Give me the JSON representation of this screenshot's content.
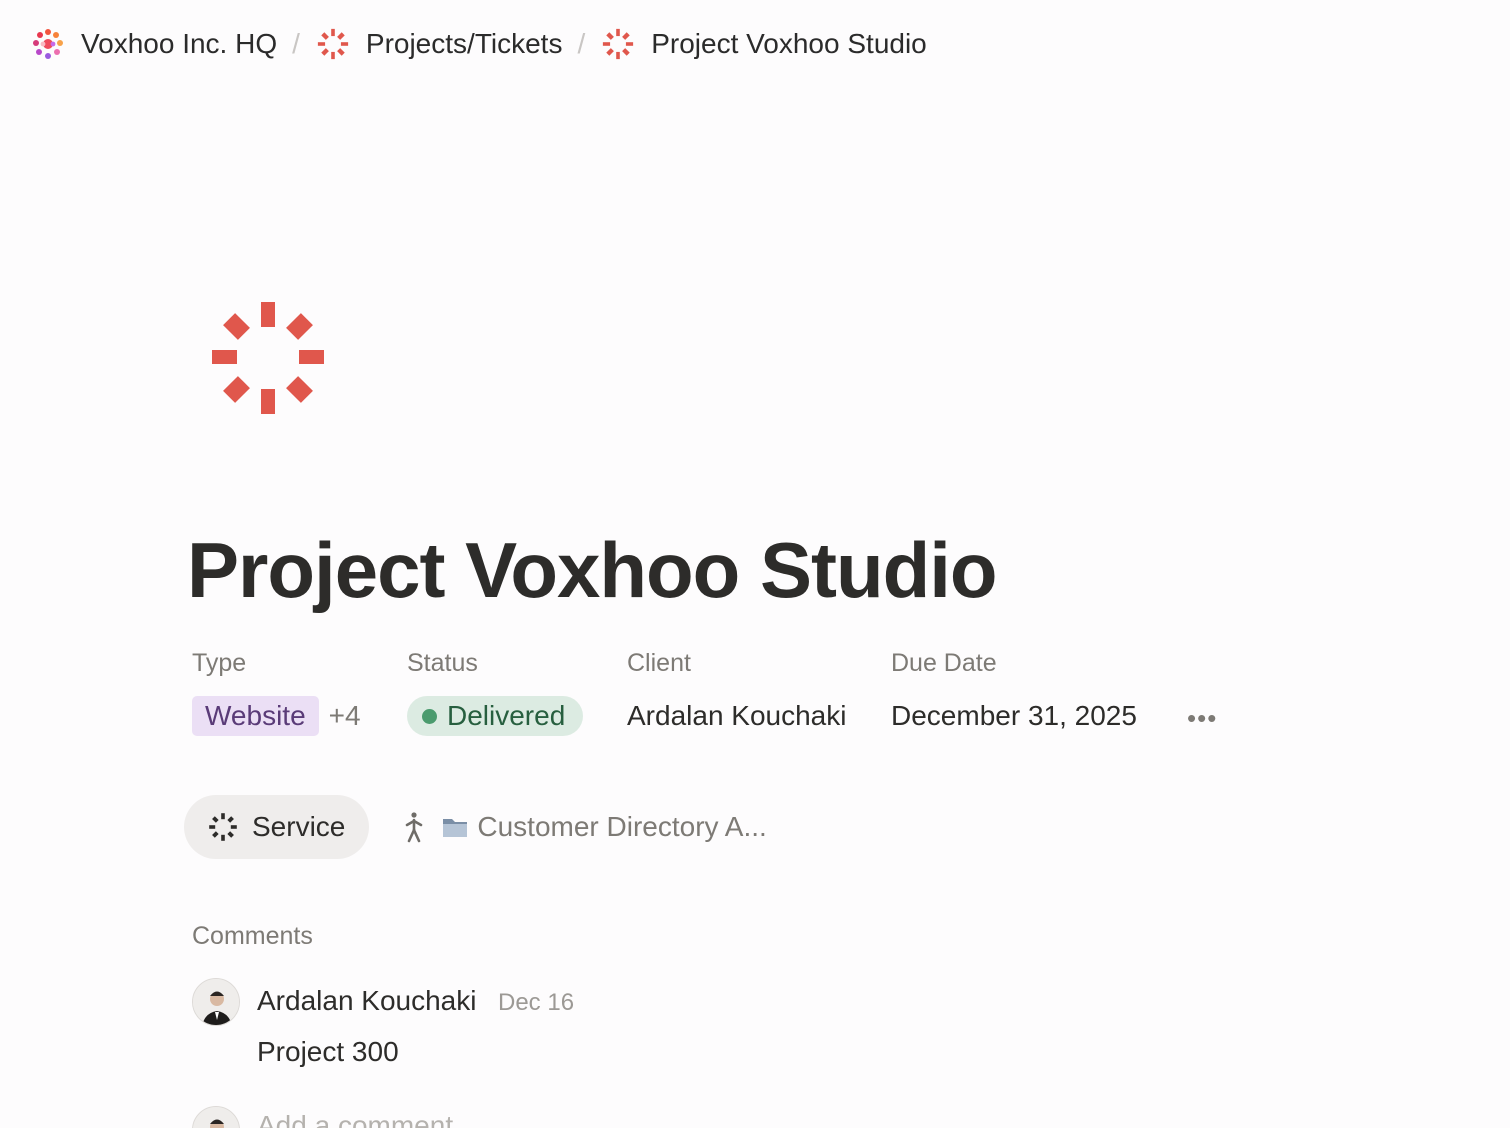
{
  "breadcrumb": {
    "items": [
      {
        "label": "Voxhoo Inc. HQ",
        "icon": "workspace-logo-icon"
      },
      {
        "label": "Projects/Tickets",
        "icon": "red-burst-icon"
      },
      {
        "label": "Project Voxhoo Studio",
        "icon": "red-burst-icon"
      }
    ],
    "separator": "/"
  },
  "page": {
    "icon": "red-burst-icon",
    "title": "Project Voxhoo Studio"
  },
  "properties": {
    "type": {
      "label": "Type",
      "value": "Website",
      "more": "+4"
    },
    "status": {
      "label": "Status",
      "value": "Delivered",
      "color": "#4b9b6e"
    },
    "client": {
      "label": "Client",
      "value": "Ardalan Kouchaki"
    },
    "due_date": {
      "label": "Due Date",
      "value": "December 31, 2025"
    },
    "more_label": "•••"
  },
  "relations": {
    "service_chip": {
      "label": "Service",
      "icon": "dark-burst-icon"
    },
    "directory_link": {
      "label": "Customer Directory A...",
      "icons": [
        "walking-person-icon",
        "folder-icon"
      ]
    }
  },
  "comments": {
    "heading": "Comments",
    "items": [
      {
        "author": "Ardalan Kouchaki",
        "date": "Dec 16",
        "body": "Project 300"
      }
    ],
    "add_placeholder": "Add a comment..."
  },
  "colors": {
    "accent_red": "#e0574c",
    "tag_purple_bg": "#ebdff5",
    "status_green_bg": "#dcebe2"
  }
}
